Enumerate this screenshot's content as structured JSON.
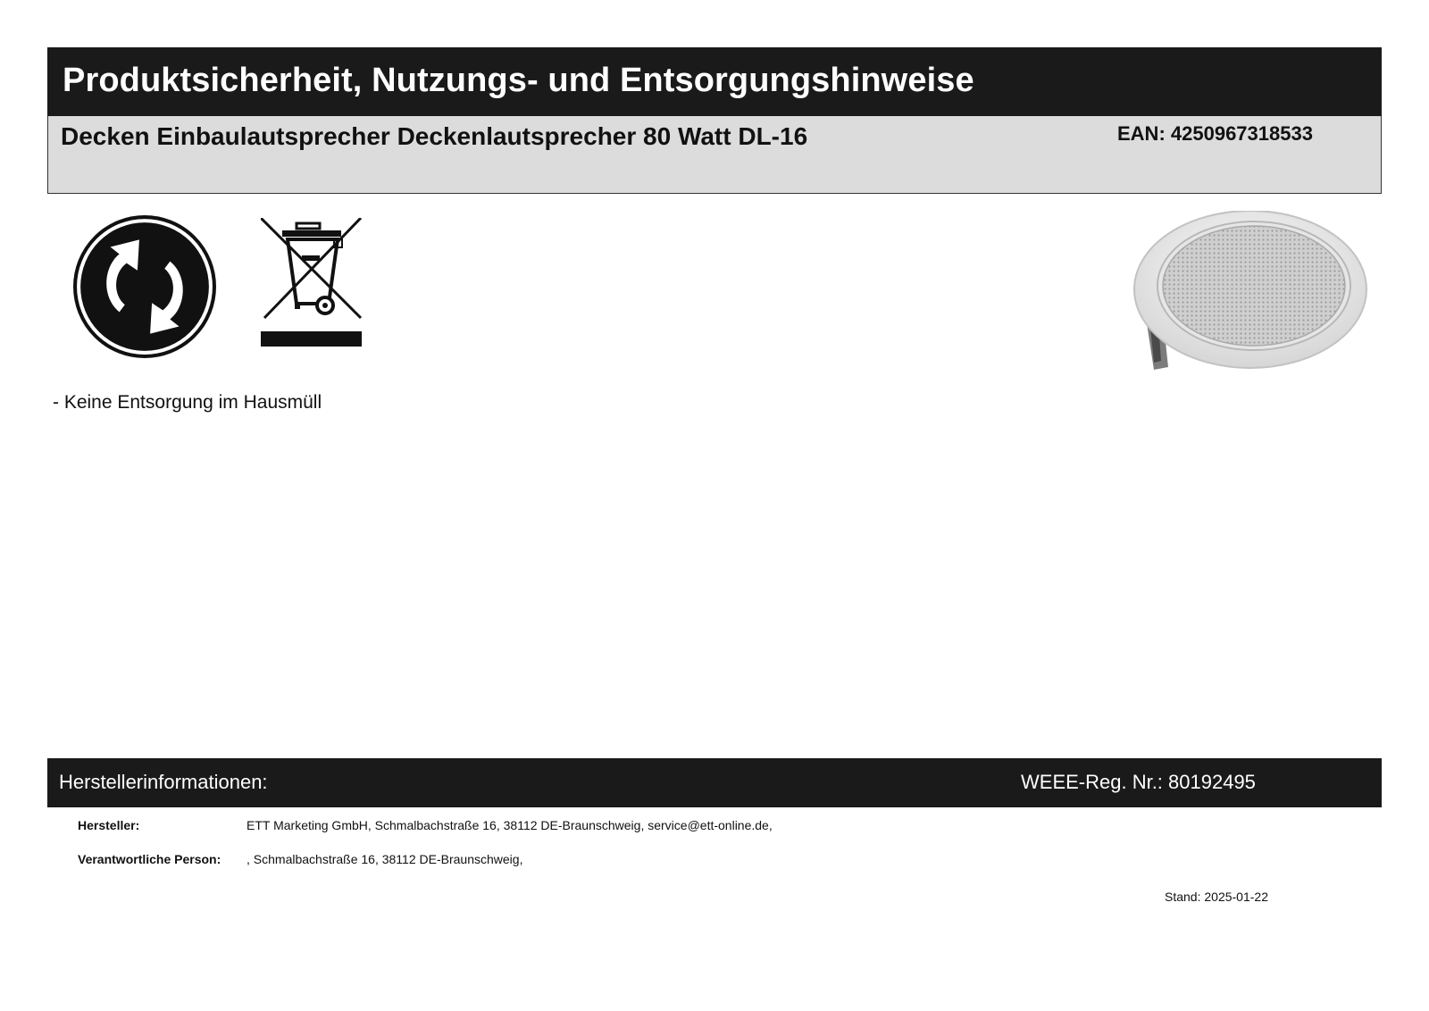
{
  "header": {
    "title": "Produktsicherheit, Nutzungs- und Entsorgungshinweise",
    "product_name": "Decken Einbaulautsprecher Deckenlautsprecher 80 Watt DL-16",
    "ean": "EAN: 4250967318533"
  },
  "icons": {
    "recycling": "green-dot-recycling-icon",
    "weee": "crossed-out-wheelie-bin-icon"
  },
  "product_image": "ceiling-speaker-image",
  "disposal": {
    "note": "- Keine Entsorgung im Hausmüll"
  },
  "manufacturer": {
    "section_title": "Herstellerinformationen:",
    "weee_reg": "WEEE-Reg. Nr.: 80192495",
    "rows": [
      {
        "label": "Hersteller:",
        "value": "ETT Marketing GmbH, Schmalbachstraße 16, 38112 DE-Braunschweig, service@ett-online.de,"
      },
      {
        "label": "Verantwortliche Person:",
        "value": ", Schmalbachstraße 16, 38112 DE-Braunschweig,"
      }
    ]
  },
  "footer": {
    "stand": "Stand: 2025-01-22"
  },
  "colors": {
    "header_bg": "#1a1a1a",
    "product_bar_bg": "#dcdcdc",
    "text": "#111111"
  }
}
